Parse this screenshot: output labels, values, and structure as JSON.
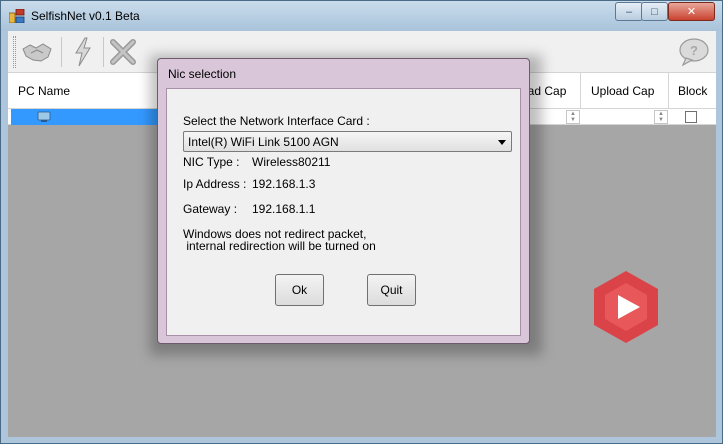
{
  "window": {
    "title": "SelfishNet v0.1 Beta",
    "controls": {
      "minimize": "–",
      "maximize": "□",
      "close": "✕"
    }
  },
  "toolbar": {
    "buttons": [
      {
        "icon": "handshake-icon"
      },
      {
        "icon": "lightning-icon"
      },
      {
        "icon": "close-x-icon"
      },
      {
        "icon": "speech-bubble-help-icon"
      }
    ]
  },
  "grid": {
    "columns": [
      "PC Name",
      "oad Cap",
      "Upload Cap",
      "Block"
    ],
    "rows": [
      {
        "selected": true,
        "block": false
      }
    ]
  },
  "dialog": {
    "title": "Nic selection",
    "select_label": "Select the Network Interface Card :",
    "selected_nic": "Intel(R) WiFi Link 5100 AGN",
    "nic_type_label": "NIC Type :",
    "nic_type_value": "Wireless80211",
    "ip_label": "Ip Address :",
    "ip_value": "192.168.1.3",
    "gateway_label": "Gateway :",
    "gateway_value": "192.168.1.1",
    "warning_line1": "Windows does not redirect packet,",
    "warning_line2": " internal redirection will be turned on",
    "ok_label": "Ok",
    "quit_label": "Quit"
  },
  "colors": {
    "selection": "#3399ff",
    "watermark": "#e03a3e",
    "client_bg": "#a6a6a6"
  }
}
